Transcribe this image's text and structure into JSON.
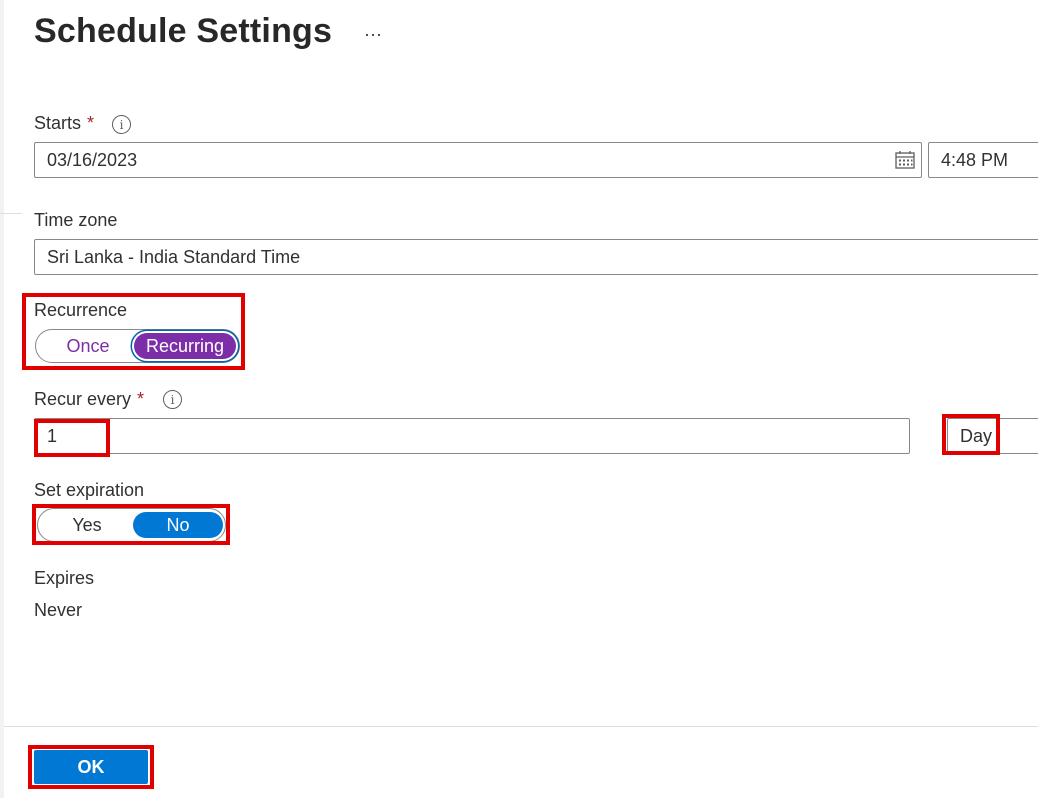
{
  "header": {
    "title": "Schedule Settings",
    "more_label": "···"
  },
  "starts": {
    "label": "Starts",
    "required_mark": "*",
    "info_glyph": "i",
    "date": "03/16/2023",
    "time": "4:48 PM"
  },
  "time_zone": {
    "label": "Time zone",
    "value": "Sri Lanka - India Standard Time"
  },
  "recurrence": {
    "label": "Recurrence",
    "options": [
      "Once",
      "Recurring"
    ],
    "selected": "Recurring",
    "accent_color": "#7b2ea8"
  },
  "recur_every": {
    "label": "Recur every",
    "required_mark": "*",
    "info_glyph": "i",
    "value": "1",
    "unit": "Day"
  },
  "set_expiration": {
    "label": "Set expiration",
    "options": [
      "Yes",
      "No"
    ],
    "selected": "No",
    "accent_color": "#0078d4"
  },
  "expires": {
    "label": "Expires",
    "value": "Never"
  },
  "footer": {
    "ok_label": "OK",
    "button_color": "#0078d4"
  },
  "highlight_color": "#e00000"
}
